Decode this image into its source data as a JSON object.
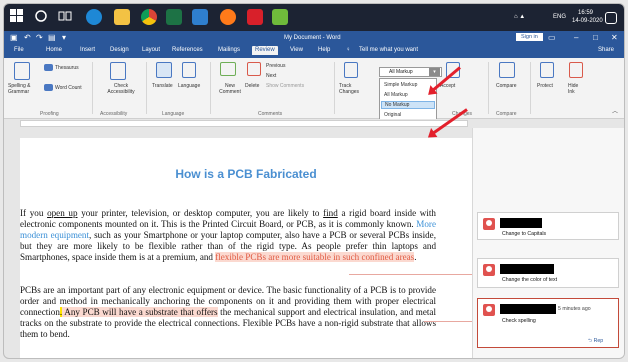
{
  "taskbar": {
    "icons": [
      "windows-icon",
      "search-icon",
      "task-view-icon",
      "edge-icon",
      "file-explorer-icon",
      "chrome-icon",
      "excel-icon",
      "powerpoint-icon",
      "firefox-icon",
      "acrobat-icon",
      "notepad-icon"
    ],
    "lang": "ENG",
    "time": "16:59",
    "date": "14-09-2020"
  },
  "titlebar": {
    "title": "My Document - Word",
    "sign_in": "Sign in"
  },
  "tabs": [
    "File",
    "Home",
    "Insert",
    "Design",
    "Layout",
    "References",
    "Mailings",
    "Review",
    "View",
    "Help"
  ],
  "active_tab": "Review",
  "tell_me": "Tell me what you want",
  "share": "Share",
  "ribbon": {
    "proofing": {
      "group": "Proofing",
      "spelling": "Spelling & Grammar",
      "thesaurus": "Thesaurus",
      "word_count": "Word Count"
    },
    "accessibility": {
      "group": "Accessibility",
      "check": "Check Accessibility"
    },
    "language": {
      "group": "Language",
      "translate": "Translate",
      "language": "Language"
    },
    "comments": {
      "group": "Comments",
      "new": "New Comment",
      "delete": "Delete",
      "previous": "Previous",
      "next": "Next",
      "show": "Show Comments"
    },
    "tracking": {
      "track": "Track Changes"
    },
    "changes": {
      "group": "Changes",
      "accept": "Accept"
    },
    "compare": {
      "group": "Compare",
      "compare": "Compare"
    },
    "protect": {
      "protect": "Protect"
    },
    "ink": {
      "hide": "Hide Ink"
    }
  },
  "markup_dropdown": {
    "selected": "All Markup",
    "options": [
      "Simple Markup",
      "All Markup",
      "No Markup",
      "Original"
    ],
    "highlighted": "No Markup"
  },
  "document": {
    "title": "How is a PCB Fabricated",
    "p1_a": "If you ",
    "p1_open": "open up",
    "p1_b": " your printer, television, or desktop computer, you are likely to ",
    "p1_find": "find",
    "p1_c": " a rigid board inside with electronic components mounted on it. This is the Printed Circuit Board, or PCB, as it is commonly known. ",
    "p1_ins": "More modern equipment",
    "p1_d": ", such as your Smartphone or your laptop computer, also have a PCB or several PCBs inside, but they are more likely to be flexible rather than of the rigid type. As people prefer thin laptops and Smartphones, space inside them is at a premium, and ",
    "p1_fmt": "flexible PCBs are more suitable in such confined areas",
    "p1_e": ".",
    "p2_a": "PCBs are an important part of any electronic equipment or device. The basic functionality of a PCB is to provide order and method in mechanically anchoring the components on it and providing them with proper electrical connection",
    "p2_dot": ".",
    "p2_hl": " Any PCB will have a substrate that offers",
    "p2_b": " the mechanical support and electrical insulation, and metal tracks on the substrate to provide the electrical connections. Flexible PCBs have a non-rigid substrate that allows them to bend."
  },
  "comments": [
    {
      "text": "Change to Capitals"
    },
    {
      "text": "Change the color of text"
    },
    {
      "meta": "5 minutes ago",
      "text": "Check spelling"
    }
  ],
  "reply": "Rep",
  "colors": {
    "word_blue": "#2b579a",
    "insert": "#3a8fd6",
    "comment_hl": "#fbd9d0",
    "arrow": "#e3202c",
    "title": "#4a8fd1"
  }
}
